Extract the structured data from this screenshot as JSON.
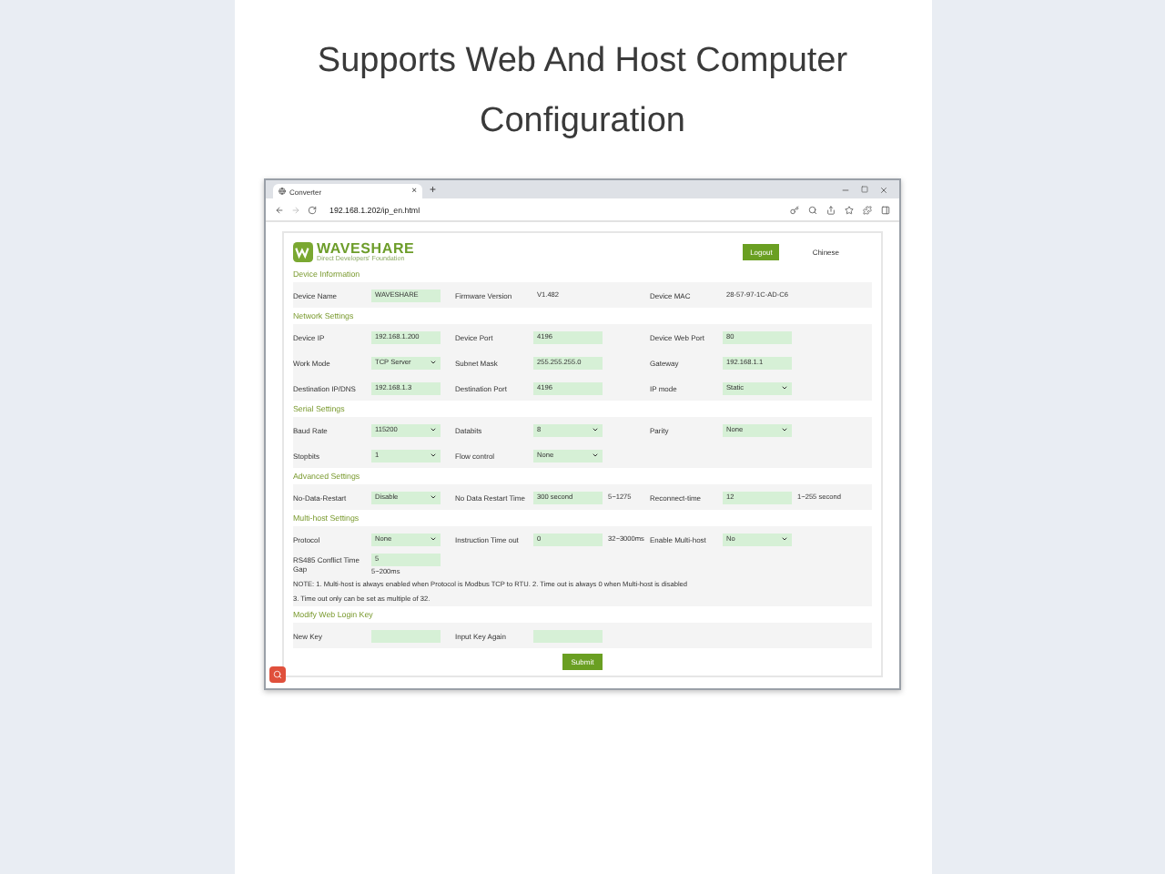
{
  "headline": [
    "Supports Web And Host Computer",
    "Configuration"
  ],
  "browser": {
    "tab": {
      "title": "Converter",
      "close": "×"
    },
    "new_tab": "+",
    "url": "192.168.1.202/ip_en.html"
  },
  "header": {
    "logo": {
      "name": "WAVESHARE",
      "tagline": "Direct Developers' Foundation"
    },
    "logout": "Logout",
    "language": "Chinese"
  },
  "sections": [
    {
      "title": "Device Information",
      "rows": [
        [
          {
            "label": "Device Name",
            "kind": "input",
            "value": "WAVESHARE"
          },
          {
            "label": "Firmware Version",
            "kind": "text",
            "value": "V1.482"
          },
          {
            "label": "Device MAC",
            "kind": "text",
            "value": "28-57-97-1C-AD-C6"
          }
        ]
      ]
    },
    {
      "title": "Network Settings",
      "rows": [
        [
          {
            "label": "Device IP",
            "kind": "input",
            "value": "192.168.1.200"
          },
          {
            "label": "Device Port",
            "kind": "input",
            "value": "4196"
          },
          {
            "label": "Device Web Port",
            "kind": "input",
            "value": "80"
          }
        ],
        [
          {
            "label": "Work Mode",
            "kind": "select",
            "value": "TCP Server"
          },
          {
            "label": "Subnet Mask",
            "kind": "input",
            "value": "255.255.255.0"
          },
          {
            "label": "Gateway",
            "kind": "input",
            "value": "192.168.1.1"
          }
        ],
        [
          {
            "label": "Destination IP/DNS",
            "kind": "input",
            "value": "192.168.1.3"
          },
          {
            "label": "Destination Port",
            "kind": "input",
            "value": "4196"
          },
          {
            "label": "IP mode",
            "kind": "select",
            "value": "Static"
          }
        ]
      ]
    },
    {
      "title": "Serial Settings",
      "rows": [
        [
          {
            "label": "Baud Rate",
            "kind": "select",
            "value": "115200"
          },
          {
            "label": "Databits",
            "kind": "select",
            "value": "8"
          },
          {
            "label": "Parity",
            "kind": "select",
            "value": "None"
          }
        ],
        [
          {
            "label": "Stopbits",
            "kind": "select",
            "value": "1"
          },
          {
            "label": "Flow control",
            "kind": "select",
            "value": "None"
          }
        ]
      ]
    },
    {
      "title": "Advanced Settings",
      "rows": [
        [
          {
            "label": "No-Data-Restart",
            "kind": "select",
            "value": "Disable"
          },
          {
            "label": "No Data Restart Time",
            "kind": "input",
            "value": "300 second",
            "hint": "5~1275"
          },
          {
            "label": "Reconnect-time",
            "kind": "input",
            "value": "12",
            "hint": "1~255 second"
          }
        ]
      ]
    },
    {
      "title": "Multi-host Settings",
      "rows": [
        [
          {
            "label": "Protocol",
            "kind": "select",
            "value": "None"
          },
          {
            "label": "Instruction Time out",
            "kind": "input",
            "value": "0",
            "hint": "32~3000ms"
          },
          {
            "label": "Enable Multi-host",
            "kind": "select",
            "value": "No"
          }
        ],
        [
          {
            "label": "RS485 Conflict Time Gap",
            "kind": "input",
            "value": "5",
            "hint": "5~200ms"
          }
        ]
      ],
      "notes": [
        "NOTE: 1. Multi-host is always enabled when Protocol is Modbus TCP to RTU. 2. Time out is always 0 when Multi-host is disabled",
        "3. Time out only can be set as multiple of 32."
      ]
    },
    {
      "title": "Modify Web Login Key",
      "rows": [
        [
          {
            "label": "New Key",
            "kind": "input"
          },
          {
            "label": "Input Key Again",
            "kind": "input"
          }
        ]
      ]
    }
  ],
  "submit": "Submit"
}
